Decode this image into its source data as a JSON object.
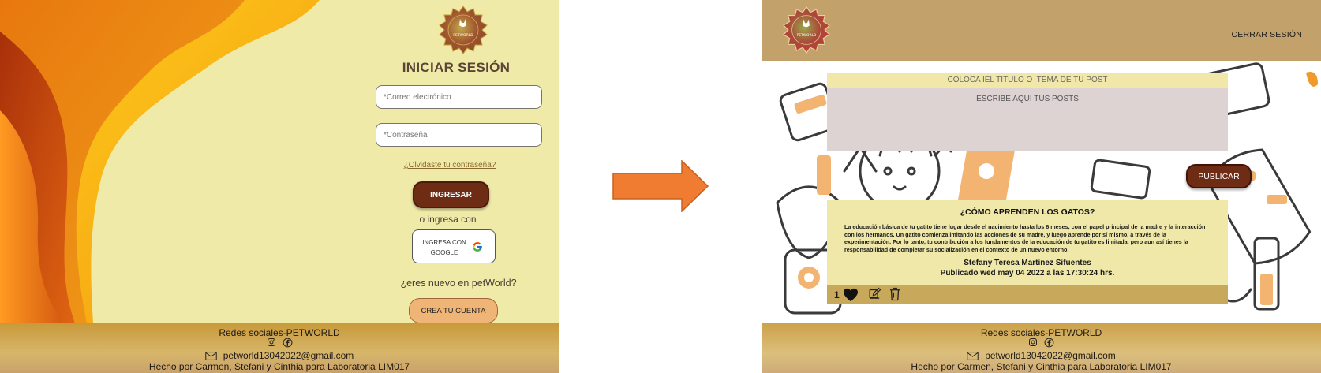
{
  "login": {
    "brand": "PETWORLD",
    "title": "INICIAR SESIÓN",
    "email_placeholder": "*Correo electrónico",
    "password_placeholder": "*Contraseña",
    "forgot_link": "¿Olvidaste tu contraseña?",
    "login_button": "INGRESAR",
    "or_text": "o ingresa con",
    "google_button_line1": "INGRESA CON",
    "google_button_line2": "GOOGLE",
    "new_user_text": "¿eres nuevo en petWorld?",
    "create_account_button": "CREA TU CUENTA"
  },
  "footer": {
    "social_title": "Redes sociales-PETWORLD",
    "email": "petworld13042022@gmail.com",
    "credits": "Hecho por Carmen, Stefani y Cinthia para Laboratoria LIM017"
  },
  "feed": {
    "brand": "PETWORLD",
    "logout": "CERRAR SESIÓN",
    "title_placeholder": "COLOCA IEL TITULO O  TEMA DE TU POST",
    "body_placeholder": "ESCRIBE AQUI TUS POSTS",
    "publish_button": "PUBLICAR",
    "post": {
      "heading": "¿CÓMO APRENDEN LOS GATOS?",
      "text": "La educación básica de tu gatito tiene lugar desde el nacimiento hasta los 6 meses, con el papel principal de la madre y la interacción con los hermanos. Un gatito comienza imitando las acciones de su madre, y luego aprende por sí mismo, a través de la experimentación. Por lo tanto, tu contribución a los fundamentos de la educación de tu gatito es limitada, pero aun así tienes la responsabilidad de completar su socialización en el contexto de un nuevo entorno.",
      "author": "Stefany Teresa Martinez Sifuentes",
      "date": "Publicado  wed may  04 2022 a las 17:30:24 hrs.",
      "likes": "1"
    }
  },
  "colors": {
    "login_bg": "#f0eaa8",
    "brown_button": "#6e2c14",
    "feed_header": "#c2a16a",
    "post_card": "#efe8a8",
    "post_actions": "#c8a85a",
    "arrow": "#ef7c31",
    "create_button": "#efb577"
  },
  "icons": [
    "paw-logo-icon",
    "instagram-icon",
    "facebook-icon",
    "mail-icon",
    "google-icon",
    "flow-arrow-icon",
    "heart-icon",
    "edit-icon",
    "trash-icon"
  ]
}
